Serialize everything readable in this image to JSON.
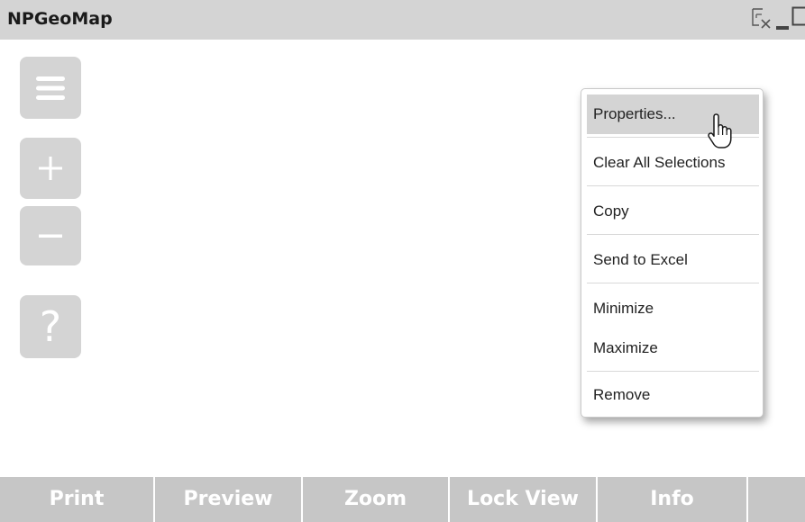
{
  "window": {
    "title": "NPGeoMap"
  },
  "titlebar_icons": [
    "clear-selections-icon",
    "minimize-icon",
    "maximize-icon"
  ],
  "map_controls": {
    "menu_icon": "hamburger-menu-icon",
    "zoom_in_icon": "plus-icon",
    "zoom_out_icon": "minus-icon",
    "help_label": "?"
  },
  "context_menu": {
    "items": [
      {
        "label": "Properties...",
        "highlighted": true
      },
      {
        "label": "Clear All Selections"
      },
      {
        "label": "Copy"
      },
      {
        "label": "Send to Excel"
      },
      {
        "label": "Minimize"
      },
      {
        "label": "Maximize"
      },
      {
        "label": "Remove"
      }
    ]
  },
  "bottom_bar": {
    "buttons": [
      {
        "label": "Print"
      },
      {
        "label": "Preview"
      },
      {
        "label": "Zoom"
      },
      {
        "label": "Lock View"
      },
      {
        "label": "Info"
      },
      {
        "label": ""
      }
    ]
  },
  "colors": {
    "titlebar_bg": "#d4d4d4",
    "control_bg": "#d4d4d4",
    "bottom_bar_bg": "#c6c6c6",
    "menu_highlight": "#d4d4d4"
  }
}
